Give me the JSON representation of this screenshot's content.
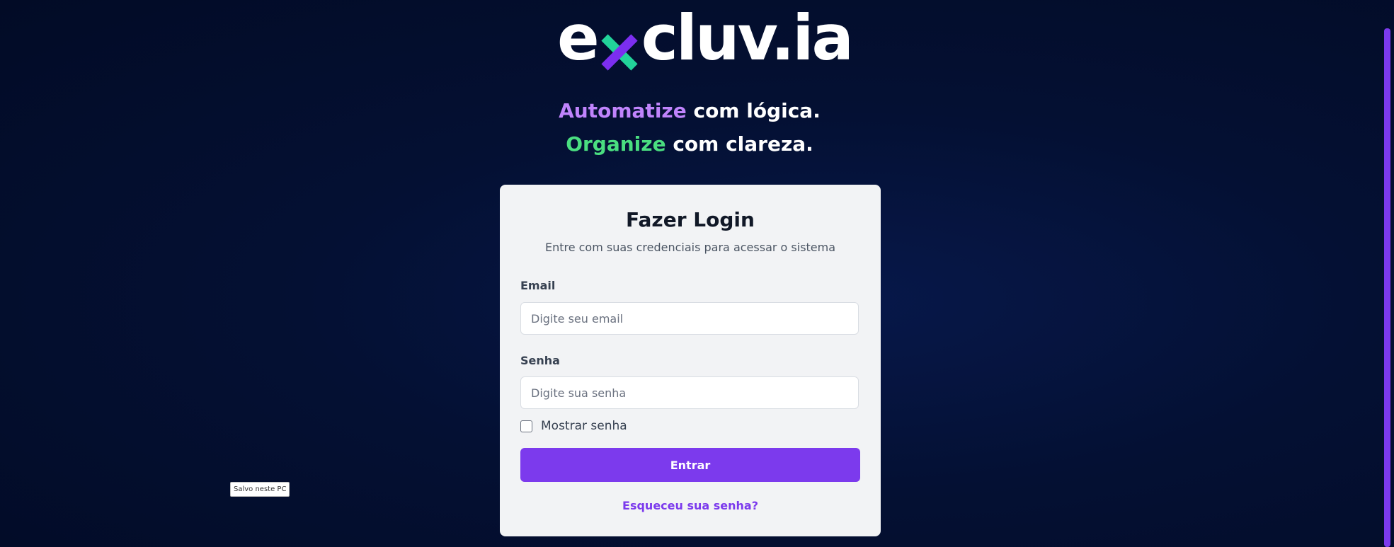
{
  "brand": {
    "logo_prefix": "e",
    "logo_suffix": "cluv.ia",
    "logo_mark_icon": "x-mark-icon"
  },
  "tagline": {
    "line1_accent": "Automatize",
    "line1_rest": "com lógica.",
    "line2_accent": "Organize",
    "line2_rest": "com clareza."
  },
  "login": {
    "title": "Fazer Login",
    "subtitle": "Entre com suas credenciais para acessar o sistema",
    "email_label": "Email",
    "email_placeholder": "Digite seu email",
    "email_value": "",
    "password_label": "Senha",
    "password_placeholder": "Digite sua senha",
    "password_value": "",
    "show_password_label": "Mostrar senha",
    "show_password_checked": false,
    "submit_label": "Entrar",
    "forgot_label": "Esqueceu sua senha?"
  },
  "tooltip": {
    "text": "Salvo neste PC"
  },
  "colors": {
    "background": "#030f2e",
    "accent_purple": "#c084fc",
    "accent_green": "#4ade80",
    "primary": "#7c3aed",
    "card": "#f2f3f5"
  }
}
